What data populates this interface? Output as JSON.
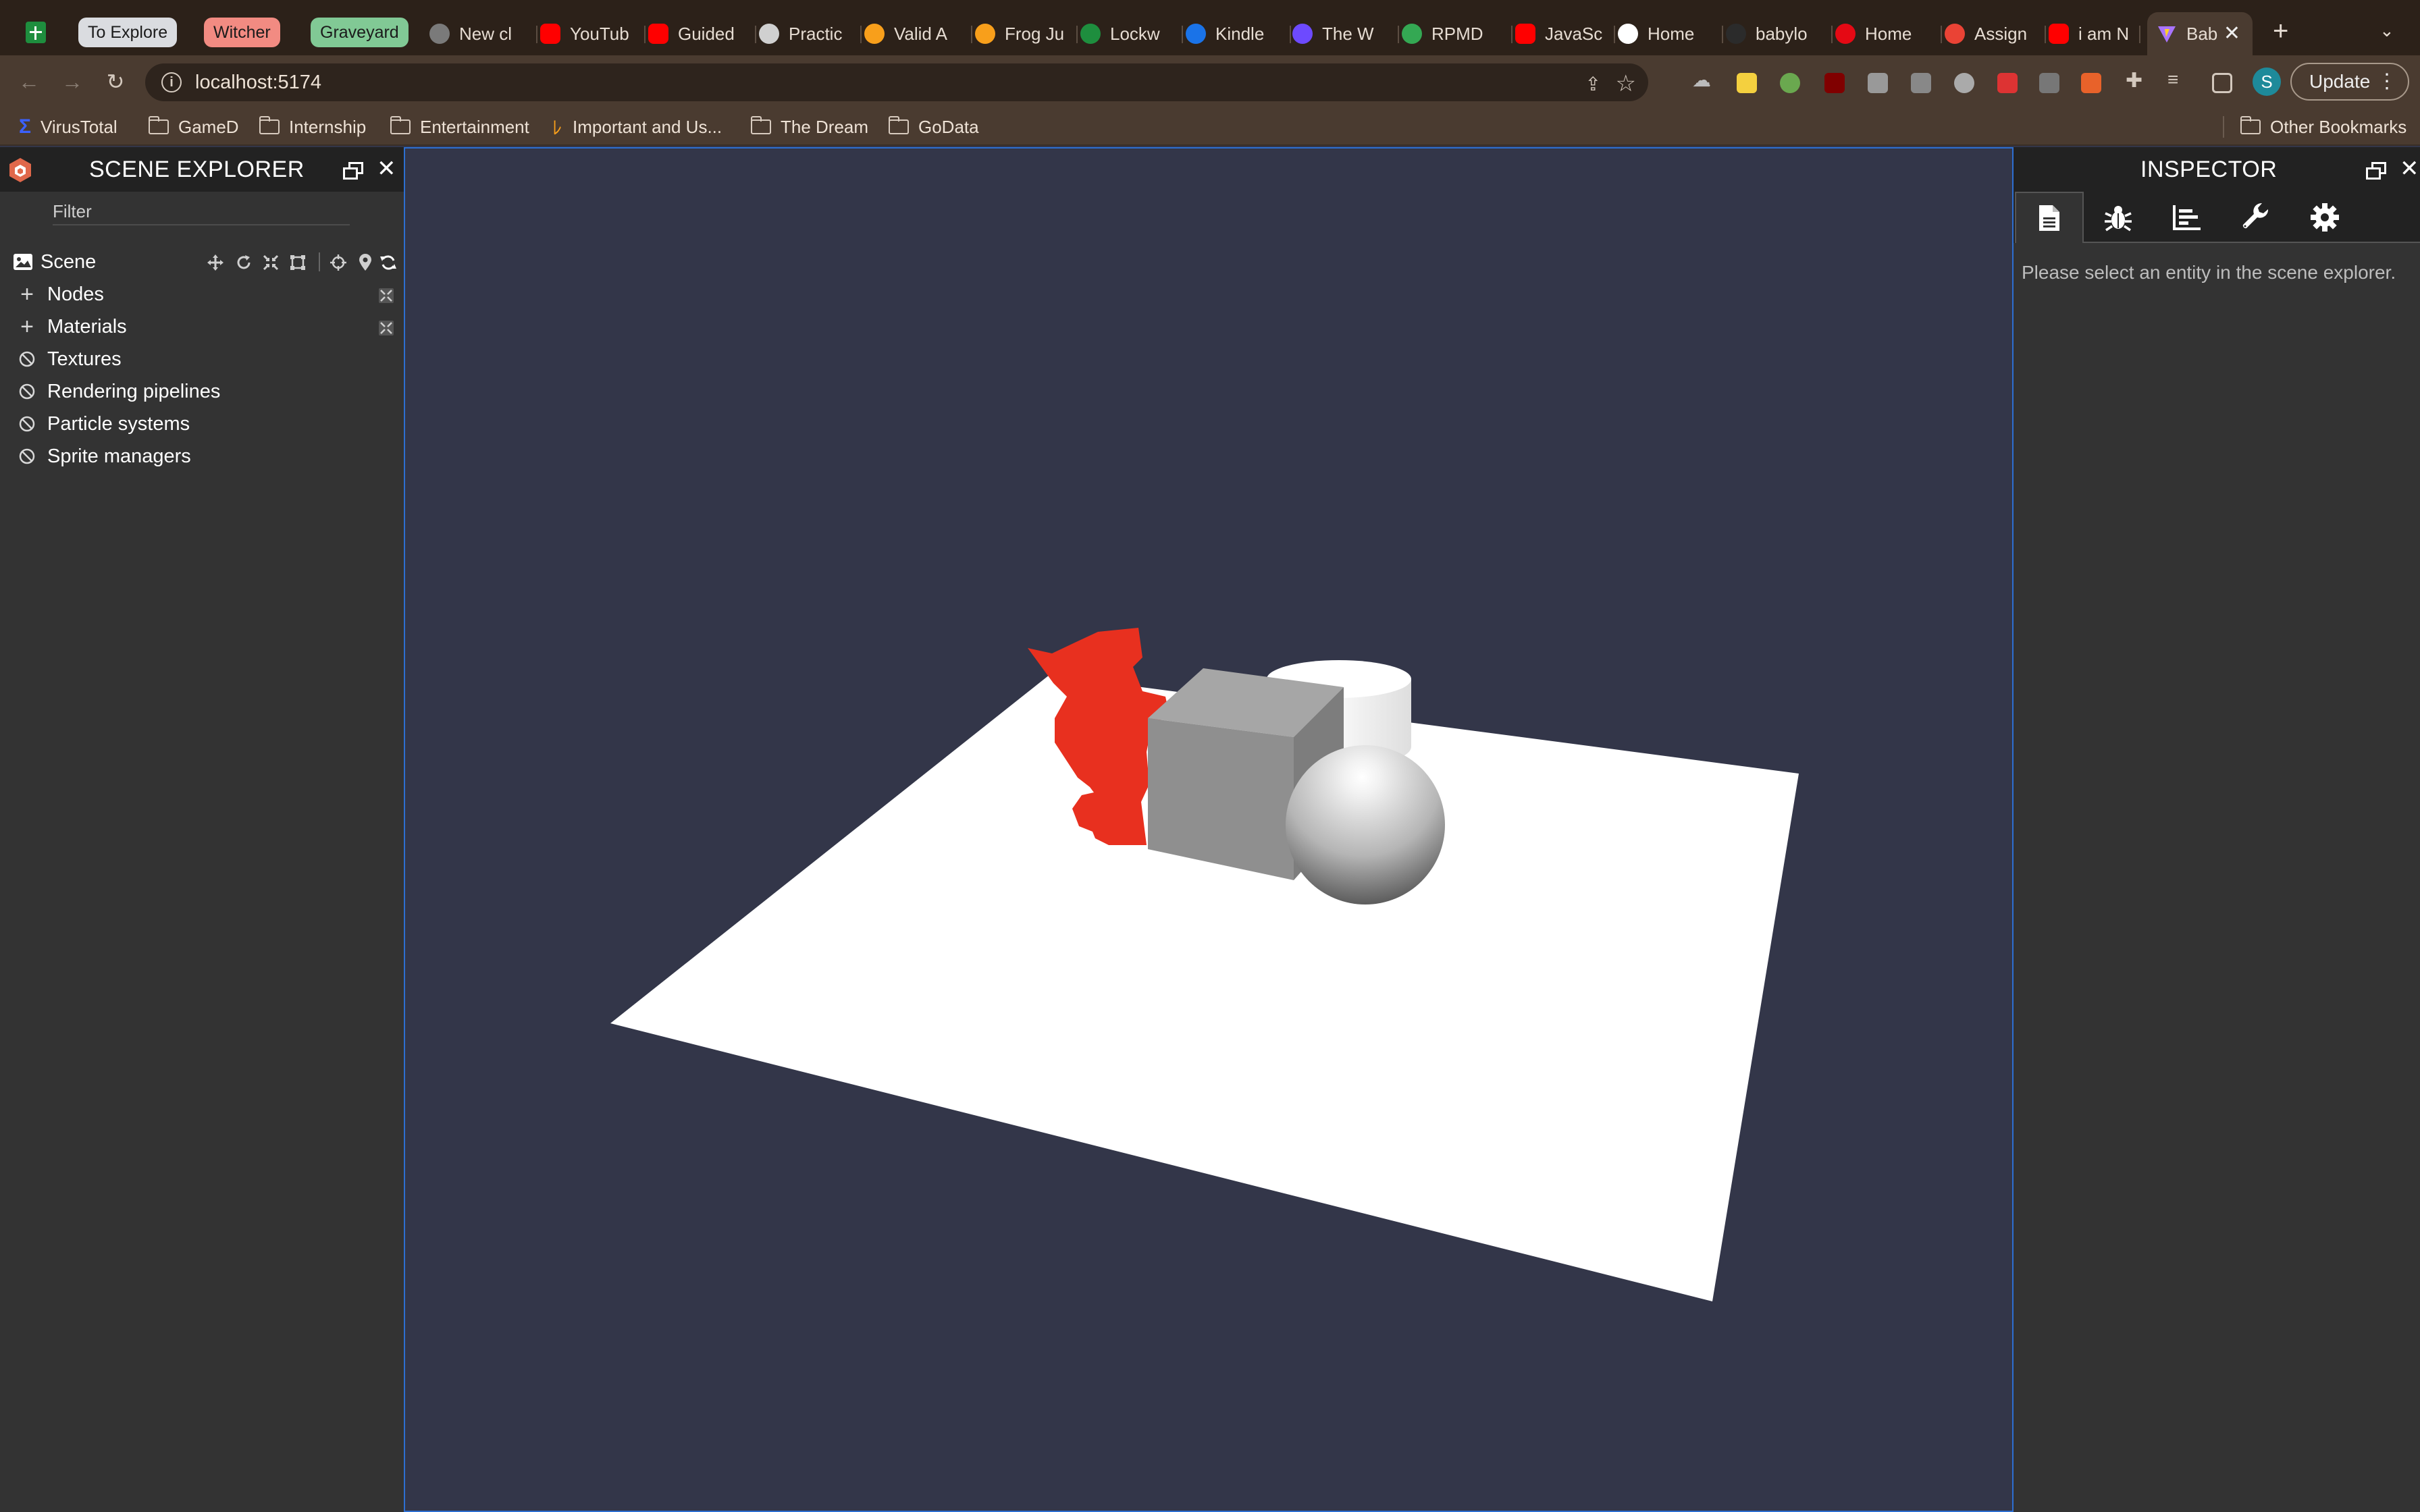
{
  "tabs": {
    "groups": [
      {
        "label": "To Explore",
        "color": "#dadce0"
      },
      {
        "label": "Witcher",
        "color": "#f28b82"
      },
      {
        "label": "Graveyard",
        "color": "#81c995"
      }
    ],
    "items": [
      {
        "title": "New cl",
        "icon": "chatgpt-icon",
        "color": "#7a7a7a"
      },
      {
        "title": "YouTub",
        "icon": "youtube-music-icon",
        "color": "#ff0000"
      },
      {
        "title": "Guided",
        "icon": "youtube-icon",
        "color": "#ff0000"
      },
      {
        "title": "Practic",
        "icon": "bell-icon",
        "color": "#d0d0d0"
      },
      {
        "title": "Valid A",
        "icon": "leetcode-icon",
        "color": "#f89f1b"
      },
      {
        "title": "Frog Ju",
        "icon": "leetcode-icon",
        "color": "#f89f1b"
      },
      {
        "title": "Lockw",
        "icon": "sheets-icon",
        "color": "#1e8e3e"
      },
      {
        "title": "Kindle",
        "icon": "kindle-icon",
        "color": "#1a73e8"
      },
      {
        "title": "The W",
        "icon": "proton-icon",
        "color": "#6d4aff"
      },
      {
        "title": "RPMD",
        "icon": "asterisk-icon",
        "color": "#34a853"
      },
      {
        "title": "JavaSc",
        "icon": "youtube-icon",
        "color": "#ff0000"
      },
      {
        "title": "Home",
        "icon": "wix-icon",
        "color": "#ffffff"
      },
      {
        "title": "babylo",
        "icon": "github-icon",
        "color": "#2b2b2b"
      },
      {
        "title": "Home",
        "icon": "netflix-icon",
        "color": "#e50914"
      },
      {
        "title": "Assign",
        "icon": "gmail-icon",
        "color": "#ea4335"
      },
      {
        "title": "i am N",
        "icon": "youtube-icon",
        "color": "#ff0000"
      }
    ],
    "active": {
      "title": "Bab",
      "icon": "vite-icon",
      "color": "#a974ff"
    }
  },
  "toolbar": {
    "url": "localhost:5174",
    "update_label": "Update",
    "profile_initial": "S"
  },
  "bookmarks": {
    "items": [
      {
        "label": "VirusTotal",
        "icon": "virustotal-icon"
      },
      {
        "label": "GameD",
        "icon": "folder-icon"
      },
      {
        "label": "Internship",
        "icon": "folder-icon"
      },
      {
        "label": "Entertainment",
        "icon": "folder-icon"
      },
      {
        "label": "Important and Us...",
        "icon": "leetcode-icon"
      },
      {
        "label": "The Dream",
        "icon": "folder-icon"
      },
      {
        "label": "GoData",
        "icon": "folder-icon"
      }
    ],
    "other": "Other Bookmarks"
  },
  "explorer": {
    "title": "SCENE EXPLORER",
    "filter_placeholder": "Filter",
    "scene_label": "Scene",
    "tree": [
      {
        "label": "Nodes",
        "state": "expandable"
      },
      {
        "label": "Materials",
        "state": "expandable"
      },
      {
        "label": "Textures",
        "state": "empty"
      },
      {
        "label": "Rendering pipelines",
        "state": "empty"
      },
      {
        "label": "Particle systems",
        "state": "empty"
      },
      {
        "label": "Sprite managers",
        "state": "empty"
      }
    ]
  },
  "inspector": {
    "title": "INSPECTOR",
    "tabs": [
      "properties",
      "debug",
      "statistics",
      "tools",
      "settings"
    ],
    "message": "Please select an entity in the scene explorer."
  },
  "scene": {
    "background": "#333649",
    "ground_color": "#ffffff",
    "cat_color": "#e8301f",
    "box_color": "#8f8f8f",
    "cylinder_color": "#f4f4f4",
    "sphere_color": "#d8d8d8"
  }
}
